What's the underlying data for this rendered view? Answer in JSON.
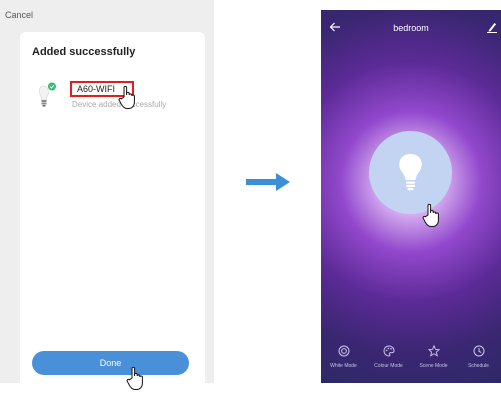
{
  "left_screen": {
    "cancel_label": "Cancel",
    "title": "Added successfully",
    "device": {
      "name": "A60-WIFI",
      "status": "Device added successfully"
    },
    "done_label": "Done"
  },
  "right_screen": {
    "title": "bedroom",
    "modes": [
      {
        "label": "White Mode",
        "icon": "white-mode-icon"
      },
      {
        "label": "Colour Mode",
        "icon": "palette-icon"
      },
      {
        "label": "Scene Mode",
        "icon": "star-icon"
      },
      {
        "label": "Schedule",
        "icon": "clock-icon"
      }
    ]
  },
  "colors": {
    "done_button": "#4a90d9",
    "highlight_border": "#e31d1d",
    "screen_purple": "#5b2a96",
    "bulb_circle": "#c3d3f2",
    "arrow": "#3a8fd6"
  }
}
